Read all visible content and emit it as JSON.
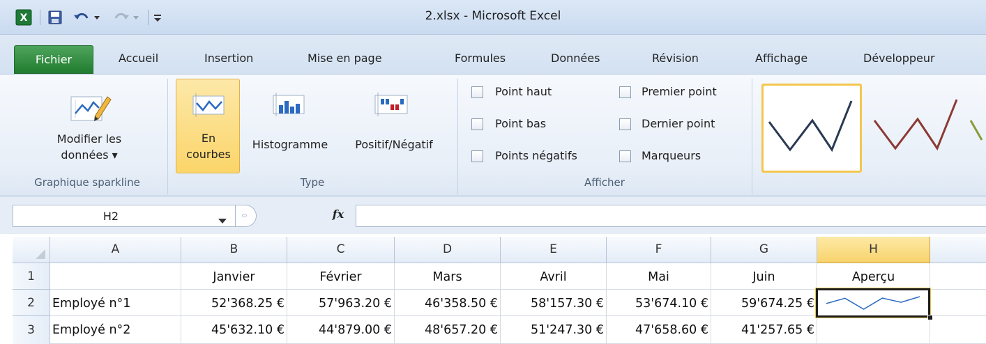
{
  "window": {
    "title": "2.xlsx  -  Microsoft Excel"
  },
  "quick_access": {
    "icons": [
      "excel-logo-icon",
      "save-icon",
      "undo-icon",
      "redo-icon",
      "customize-icon"
    ]
  },
  "tabs": {
    "file": "Fichier",
    "items": [
      "Accueil",
      "Insertion",
      "Mise en page",
      "Formules",
      "Données",
      "Révision",
      "Affichage",
      "Développeur"
    ]
  },
  "ribbon": {
    "data_group": {
      "button_line1": "Modifier les",
      "button_line2": "données ▾",
      "label": "Graphique sparkline"
    },
    "type_group": {
      "line_button_line1": "En",
      "line_button_line2": "courbes",
      "column_button": "Histogramme",
      "winloss_button": "Positif/Négatif",
      "label": "Type"
    },
    "show_group": {
      "high_point": "Point haut",
      "low_point": "Point bas",
      "negative_points": "Points négatifs",
      "first_point": "Premier point",
      "last_point": "Dernier point",
      "markers": "Marqueurs",
      "label": "Afficher"
    },
    "style_colors": [
      "#2a3a52",
      "#8b3a33",
      "#8a9a3a"
    ]
  },
  "formula_bar": {
    "name_box": "H2",
    "fx": "fx",
    "value": ""
  },
  "sheet": {
    "columns": [
      "A",
      "B",
      "C",
      "D",
      "E",
      "F",
      "G",
      "H"
    ],
    "rows": [
      {
        "num": "1",
        "cells": [
          "",
          "Janvier",
          "Février",
          "Mars",
          "Avril",
          "Mai",
          "Juin",
          "Aperçu"
        ]
      },
      {
        "num": "2",
        "cells": [
          "Employé n°1",
          "52'368.25 €",
          "57'963.20 €",
          "46'358.50 €",
          "58'157.30 €",
          "53'674.10 €",
          "59'674.25 €",
          ""
        ]
      },
      {
        "num": "3",
        "cells": [
          "Employé n°2",
          "45'632.10 €",
          "44'879.00 €",
          "48'657.20 €",
          "51'247.30 €",
          "47'658.60 €",
          "41'257.65 €",
          ""
        ]
      }
    ],
    "active_cell": "H2",
    "sparkline_values": [
      52368.25,
      57963.2,
      46358.5,
      58157.3,
      53674.1,
      59674.25
    ]
  }
}
